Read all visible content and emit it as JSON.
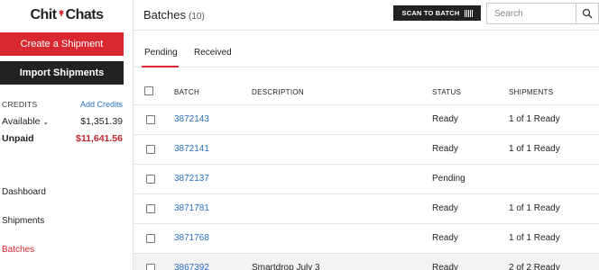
{
  "sidebar": {
    "logo": {
      "left": "Chit",
      "right": "Chats"
    },
    "create_button": "Create a Shipment",
    "import_button": "Import Shipments",
    "credits": {
      "label": "CREDITS",
      "add_link": "Add Credits",
      "available_label": "Available",
      "available_value": "$1,351.39",
      "unpaid_label": "Unpaid",
      "unpaid_value": "$11,641.56"
    },
    "nav": [
      "Dashboard",
      "Shipments",
      "Batches"
    ]
  },
  "header": {
    "title": "Batches",
    "count": "(10)",
    "scan_button": "SCAN TO BATCH",
    "search_placeholder": "Search"
  },
  "tabs": [
    "Pending",
    "Received"
  ],
  "table": {
    "headers": [
      "BATCH",
      "DESCRIPTION",
      "STATUS",
      "SHIPMENTS"
    ],
    "rows": [
      {
        "batch": "3872143",
        "description": "",
        "status": "Ready",
        "shipments": "1 of 1 Ready"
      },
      {
        "batch": "3872141",
        "description": "",
        "status": "Ready",
        "shipments": "1 of 1 Ready"
      },
      {
        "batch": "3872137",
        "description": "",
        "status": "Pending",
        "shipments": ""
      },
      {
        "batch": "3871781",
        "description": "",
        "status": "Ready",
        "shipments": "1 of 1 Ready"
      },
      {
        "batch": "3871768",
        "description": "",
        "status": "Ready",
        "shipments": "1 of 1 Ready"
      },
      {
        "batch": "3867392",
        "description": "Smartdrop July 3",
        "status": "Ready",
        "shipments": "2 of 2 Ready"
      }
    ]
  },
  "colors": {
    "brand_red": "#d9282f",
    "link_blue": "#2a6fc2",
    "dark": "#222222"
  }
}
